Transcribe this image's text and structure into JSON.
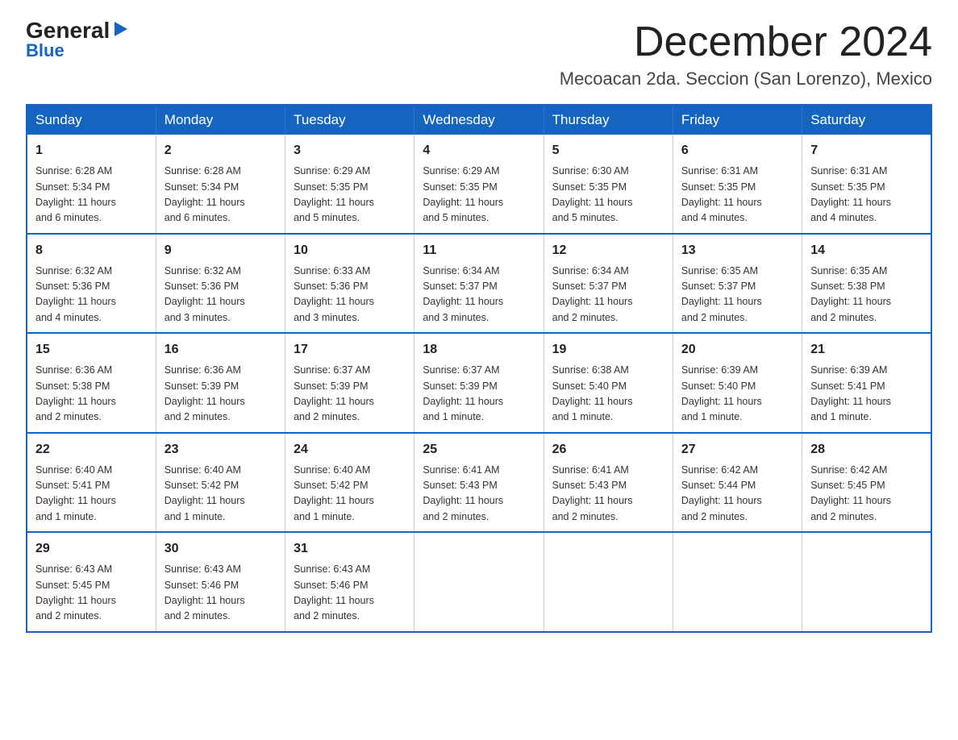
{
  "logo": {
    "general": "General",
    "triangle": "▶",
    "blue": "Blue"
  },
  "title": {
    "month": "December 2024",
    "location": "Mecoacan 2da. Seccion (San Lorenzo), Mexico"
  },
  "days_of_week": [
    "Sunday",
    "Monday",
    "Tuesday",
    "Wednesday",
    "Thursday",
    "Friday",
    "Saturday"
  ],
  "weeks": [
    [
      {
        "day": "1",
        "sunrise": "6:28 AM",
        "sunset": "5:34 PM",
        "daylight": "11 hours and 6 minutes."
      },
      {
        "day": "2",
        "sunrise": "6:28 AM",
        "sunset": "5:34 PM",
        "daylight": "11 hours and 6 minutes."
      },
      {
        "day": "3",
        "sunrise": "6:29 AM",
        "sunset": "5:35 PM",
        "daylight": "11 hours and 5 minutes."
      },
      {
        "day": "4",
        "sunrise": "6:29 AM",
        "sunset": "5:35 PM",
        "daylight": "11 hours and 5 minutes."
      },
      {
        "day": "5",
        "sunrise": "6:30 AM",
        "sunset": "5:35 PM",
        "daylight": "11 hours and 5 minutes."
      },
      {
        "day": "6",
        "sunrise": "6:31 AM",
        "sunset": "5:35 PM",
        "daylight": "11 hours and 4 minutes."
      },
      {
        "day": "7",
        "sunrise": "6:31 AM",
        "sunset": "5:35 PM",
        "daylight": "11 hours and 4 minutes."
      }
    ],
    [
      {
        "day": "8",
        "sunrise": "6:32 AM",
        "sunset": "5:36 PM",
        "daylight": "11 hours and 4 minutes."
      },
      {
        "day": "9",
        "sunrise": "6:32 AM",
        "sunset": "5:36 PM",
        "daylight": "11 hours and 3 minutes."
      },
      {
        "day": "10",
        "sunrise": "6:33 AM",
        "sunset": "5:36 PM",
        "daylight": "11 hours and 3 minutes."
      },
      {
        "day": "11",
        "sunrise": "6:34 AM",
        "sunset": "5:37 PM",
        "daylight": "11 hours and 3 minutes."
      },
      {
        "day": "12",
        "sunrise": "6:34 AM",
        "sunset": "5:37 PM",
        "daylight": "11 hours and 2 minutes."
      },
      {
        "day": "13",
        "sunrise": "6:35 AM",
        "sunset": "5:37 PM",
        "daylight": "11 hours and 2 minutes."
      },
      {
        "day": "14",
        "sunrise": "6:35 AM",
        "sunset": "5:38 PM",
        "daylight": "11 hours and 2 minutes."
      }
    ],
    [
      {
        "day": "15",
        "sunrise": "6:36 AM",
        "sunset": "5:38 PM",
        "daylight": "11 hours and 2 minutes."
      },
      {
        "day": "16",
        "sunrise": "6:36 AM",
        "sunset": "5:39 PM",
        "daylight": "11 hours and 2 minutes."
      },
      {
        "day": "17",
        "sunrise": "6:37 AM",
        "sunset": "5:39 PM",
        "daylight": "11 hours and 2 minutes."
      },
      {
        "day": "18",
        "sunrise": "6:37 AM",
        "sunset": "5:39 PM",
        "daylight": "11 hours and 1 minute."
      },
      {
        "day": "19",
        "sunrise": "6:38 AM",
        "sunset": "5:40 PM",
        "daylight": "11 hours and 1 minute."
      },
      {
        "day": "20",
        "sunrise": "6:39 AM",
        "sunset": "5:40 PM",
        "daylight": "11 hours and 1 minute."
      },
      {
        "day": "21",
        "sunrise": "6:39 AM",
        "sunset": "5:41 PM",
        "daylight": "11 hours and 1 minute."
      }
    ],
    [
      {
        "day": "22",
        "sunrise": "6:40 AM",
        "sunset": "5:41 PM",
        "daylight": "11 hours and 1 minute."
      },
      {
        "day": "23",
        "sunrise": "6:40 AM",
        "sunset": "5:42 PM",
        "daylight": "11 hours and 1 minute."
      },
      {
        "day": "24",
        "sunrise": "6:40 AM",
        "sunset": "5:42 PM",
        "daylight": "11 hours and 1 minute."
      },
      {
        "day": "25",
        "sunrise": "6:41 AM",
        "sunset": "5:43 PM",
        "daylight": "11 hours and 2 minutes."
      },
      {
        "day": "26",
        "sunrise": "6:41 AM",
        "sunset": "5:43 PM",
        "daylight": "11 hours and 2 minutes."
      },
      {
        "day": "27",
        "sunrise": "6:42 AM",
        "sunset": "5:44 PM",
        "daylight": "11 hours and 2 minutes."
      },
      {
        "day": "28",
        "sunrise": "6:42 AM",
        "sunset": "5:45 PM",
        "daylight": "11 hours and 2 minutes."
      }
    ],
    [
      {
        "day": "29",
        "sunrise": "6:43 AM",
        "sunset": "5:45 PM",
        "daylight": "11 hours and 2 minutes."
      },
      {
        "day": "30",
        "sunrise": "6:43 AM",
        "sunset": "5:46 PM",
        "daylight": "11 hours and 2 minutes."
      },
      {
        "day": "31",
        "sunrise": "6:43 AM",
        "sunset": "5:46 PM",
        "daylight": "11 hours and 2 minutes."
      },
      null,
      null,
      null,
      null
    ]
  ],
  "labels": {
    "sunrise": "Sunrise:",
    "sunset": "Sunset:",
    "daylight": "Daylight:"
  }
}
